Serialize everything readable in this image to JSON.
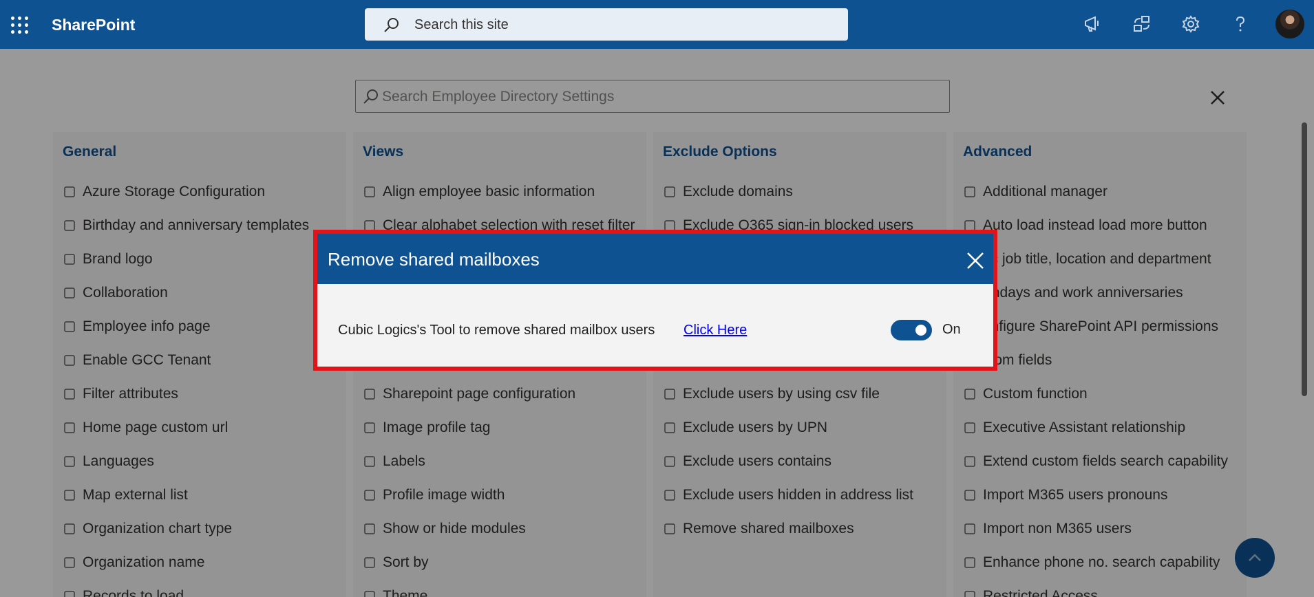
{
  "suite": {
    "brand": "SharePoint",
    "search_placeholder": "Search this site",
    "icons": [
      "megaphone-icon",
      "share-icon",
      "gear-icon",
      "help-icon"
    ]
  },
  "panel": {
    "search_placeholder": "Search Employee Directory Settings"
  },
  "columns": [
    {
      "title": "General",
      "items": [
        {
          "label": "Azure Storage Configuration",
          "icon": "database-icon"
        },
        {
          "label": "Birthday and anniversary templates",
          "icon": "cake-icon"
        },
        {
          "label": "Brand logo",
          "icon": "badge-icon"
        },
        {
          "label": "Collaboration",
          "icon": "handshake-icon"
        },
        {
          "label": "Employee info page",
          "icon": "page-icon"
        },
        {
          "label": "Enable GCC Tenant",
          "icon": "globe-icon"
        },
        {
          "label": "Filter attributes",
          "icon": "badge-check-icon"
        },
        {
          "label": "Home page custom url",
          "icon": "home-icon"
        },
        {
          "label": "Languages",
          "icon": "language-icon"
        },
        {
          "label": "Map external list",
          "icon": "map-edit-icon"
        },
        {
          "label": "Organization chart type",
          "icon": "chart-icon"
        },
        {
          "label": "Organization name",
          "icon": "org-icon"
        },
        {
          "label": "Records to load",
          "icon": "checkbox-icon"
        }
      ]
    },
    {
      "title": "Views",
      "items": [
        {
          "label": "Align employee basic information",
          "icon": "align-icon"
        },
        {
          "label": "Clear alphabet selection with reset filter",
          "icon": "filter-icon"
        },
        {
          "label": "",
          "icon": ""
        },
        {
          "label": "",
          "icon": ""
        },
        {
          "label": "",
          "icon": ""
        },
        {
          "label": "",
          "icon": ""
        },
        {
          "label": "Sharepoint page configuration",
          "icon": "eye-off-icon"
        },
        {
          "label": "Image profile tag",
          "icon": "person-icon"
        },
        {
          "label": "Labels",
          "icon": "tag-icon"
        },
        {
          "label": "Profile image width",
          "icon": "layout-icon"
        },
        {
          "label": "Show or hide modules",
          "icon": "eye-icon"
        },
        {
          "label": "Sort by",
          "icon": "sort-icon"
        },
        {
          "label": "Theme",
          "icon": "palette-icon"
        }
      ]
    },
    {
      "title": "Exclude Options",
      "items": [
        {
          "label": "Exclude domains",
          "icon": "antenna-icon"
        },
        {
          "label": "Exclude O365 sign-in blocked users",
          "icon": "person-block-icon"
        },
        {
          "label": "",
          "icon": ""
        },
        {
          "label": "",
          "icon": ""
        },
        {
          "label": "",
          "icon": ""
        },
        {
          "label": "",
          "icon": ""
        },
        {
          "label": "Exclude users by using csv file",
          "icon": "excel-icon"
        },
        {
          "label": "Exclude users by UPN",
          "icon": "signal-icon"
        },
        {
          "label": "Exclude users contains",
          "icon": "folder-search-icon"
        },
        {
          "label": "Exclude users hidden in address list",
          "icon": "list-icon"
        },
        {
          "label": "Remove shared mailboxes",
          "icon": "mailbox-icon"
        }
      ]
    },
    {
      "title": "Advanced",
      "items": [
        {
          "label": "Additional manager",
          "icon": "people-icon"
        },
        {
          "label": "Auto load instead load more button",
          "icon": "spinner-icon"
        },
        {
          "label": "nc job title, location and department",
          "icon": ""
        },
        {
          "label": "rthdays and work anniversaries",
          "icon": ""
        },
        {
          "label": "onfigure SharePoint API permissions",
          "icon": ""
        },
        {
          "label": "stom fields",
          "icon": ""
        },
        {
          "label": "Custom function",
          "icon": "search-function-icon"
        },
        {
          "label": "Executive Assistant relationship",
          "icon": "people-link-icon"
        },
        {
          "label": "Extend custom fields search capability",
          "icon": "extend-icon"
        },
        {
          "label": "Import M365 users pronouns",
          "icon": "id-card-icon"
        },
        {
          "label": "Import non M365 users",
          "icon": "arrow-import-icon"
        },
        {
          "label": "Enhance phone no. search capability",
          "icon": "phone-search-icon"
        },
        {
          "label": "Restricted Access",
          "icon": "lock-icon"
        }
      ]
    }
  ],
  "dialog": {
    "title": "Remove shared mailboxes",
    "description": "Cubic Logics's Tool to remove shared mailbox users",
    "link_text": "Click Here",
    "toggle_state": "On",
    "toggle_on": true
  },
  "colors": {
    "brand": "#0f5291",
    "highlight": "#e3131a",
    "dialog_bg": "#f3f3f3"
  }
}
